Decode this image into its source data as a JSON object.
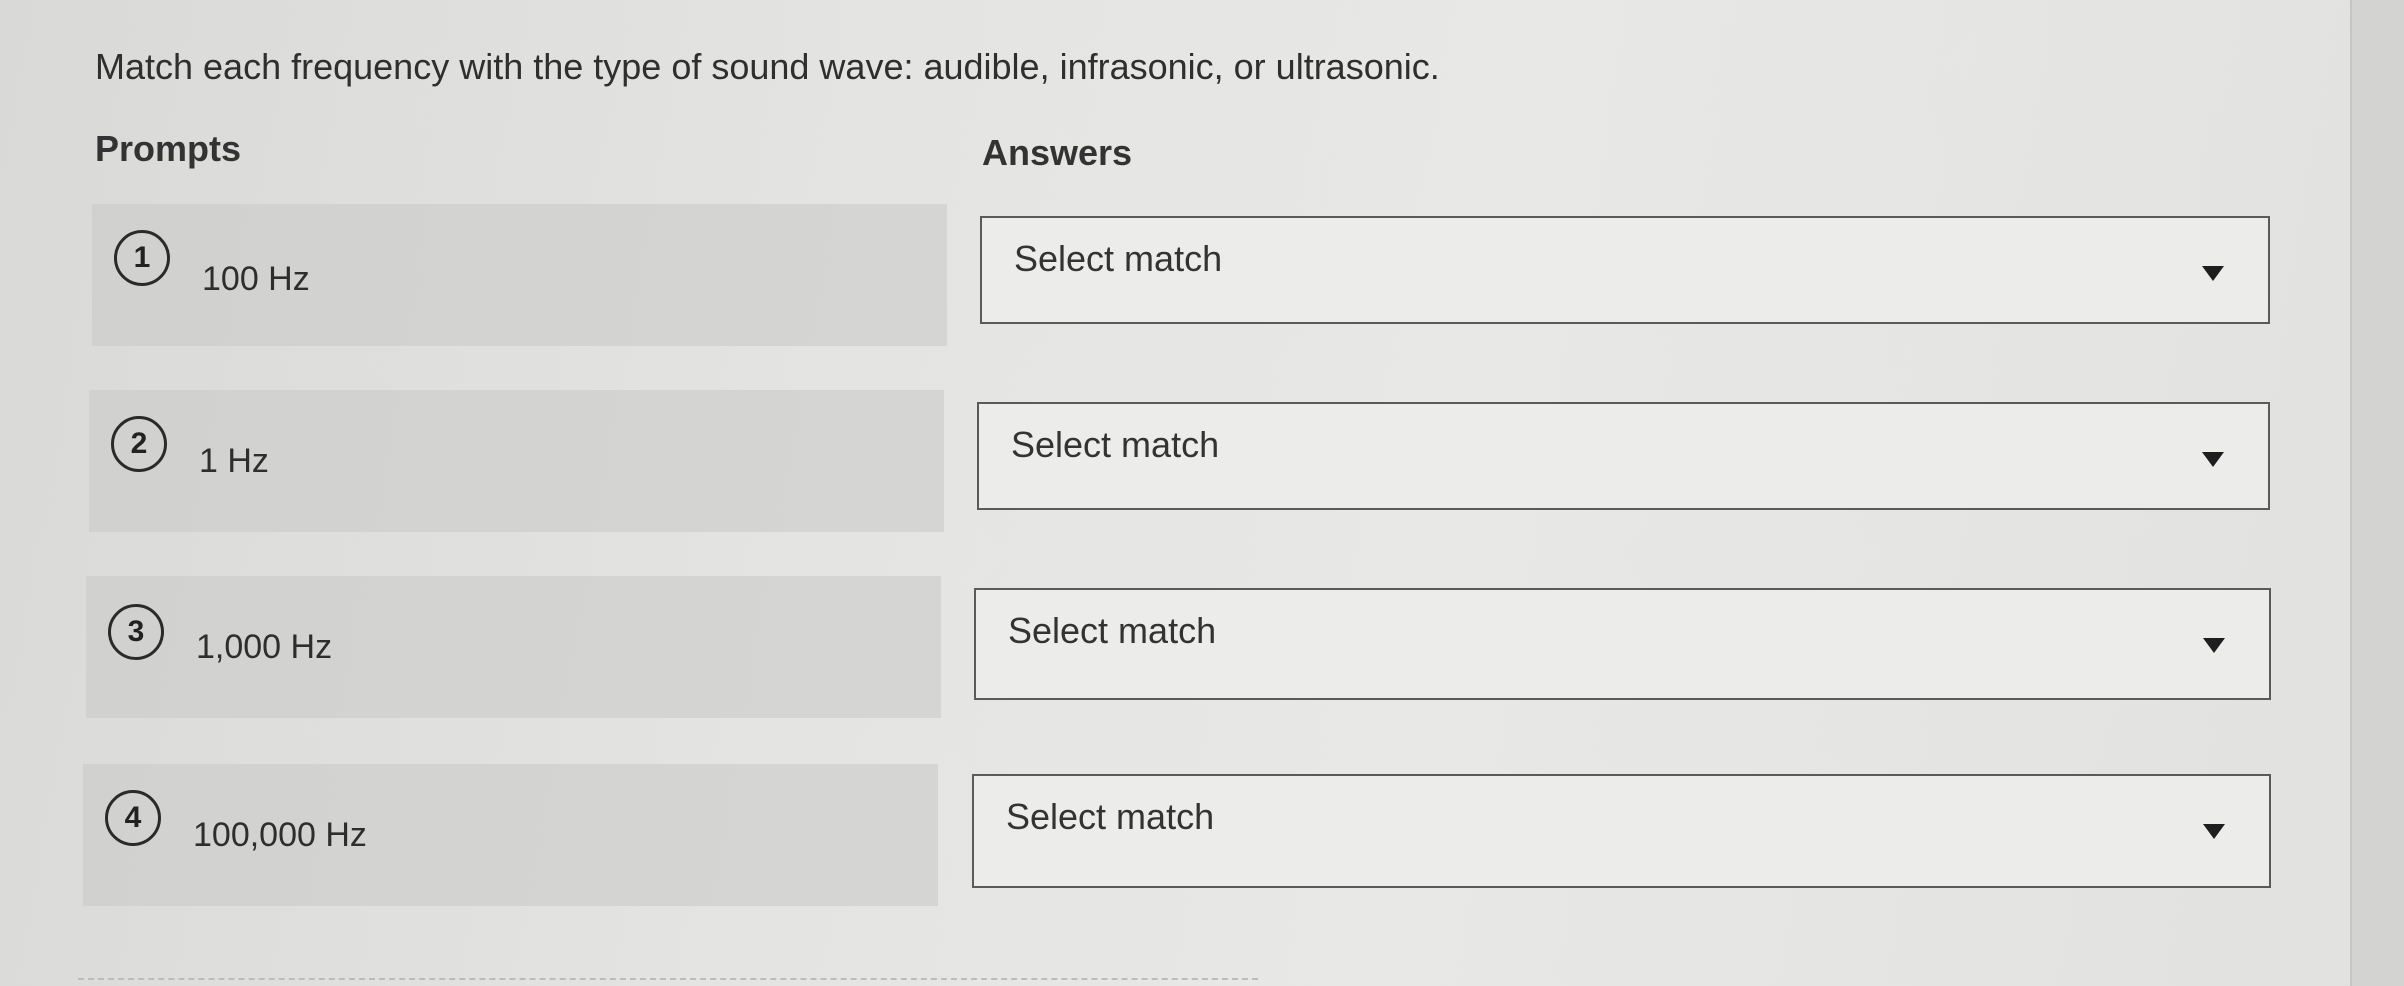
{
  "question": "Match each frequency with the type of sound wave: audible, infrasonic, or ultrasonic.",
  "prompts_heading": "Prompts",
  "answers_heading": "Answers",
  "prompts": [
    {
      "number": "1",
      "text": "100 Hz"
    },
    {
      "number": "2",
      "text": "1 Hz"
    },
    {
      "number": "3",
      "text": "1,000 Hz"
    },
    {
      "number": "4",
      "text": "100,000 Hz"
    }
  ],
  "answers": [
    {
      "placeholder": "Select match"
    },
    {
      "placeholder": "Select match"
    },
    {
      "placeholder": "Select match"
    },
    {
      "placeholder": "Select match"
    }
  ],
  "icons": {
    "dropdown": "chevron-down-icon"
  }
}
